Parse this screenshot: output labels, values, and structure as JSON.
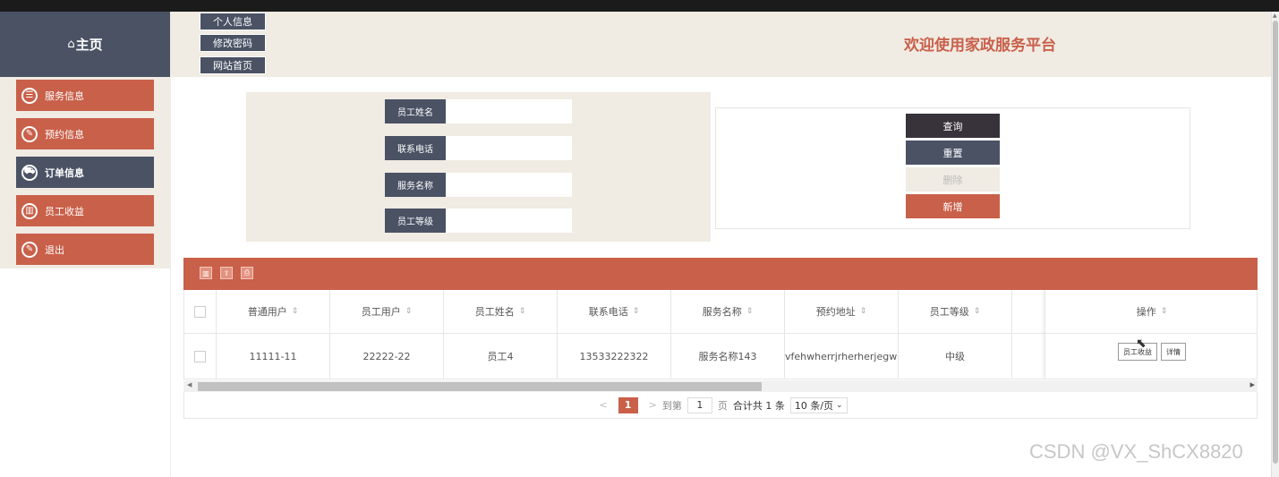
{
  "nav": {
    "home_label": "主页",
    "items": [
      {
        "label": "服务信息",
        "icon": "document-icon",
        "glyph": "☰"
      },
      {
        "label": "预约信息",
        "icon": "edit-icon",
        "glyph": "✎"
      },
      {
        "label": "订单信息",
        "icon": "bus-icon",
        "glyph": "⛟"
      },
      {
        "label": "员工收益",
        "icon": "chart-icon",
        "glyph": "▥"
      },
      {
        "label": "退出",
        "icon": "edit-icon",
        "glyph": "✎"
      }
    ],
    "active_index": 2
  },
  "header": {
    "buttons": [
      "个人信息",
      "修改密码",
      "网站首页"
    ],
    "welcome": "欢迎使用家政服务平台"
  },
  "search": {
    "fields": [
      {
        "label": "员工姓名",
        "value": ""
      },
      {
        "label": "联系电话",
        "value": ""
      },
      {
        "label": "服务名称",
        "value": ""
      },
      {
        "label": "员工等级",
        "value": ""
      }
    ]
  },
  "actions": {
    "query": "查询",
    "reset": "重置",
    "delete": "删除",
    "add": "新增"
  },
  "table": {
    "columns": [
      "普通用户",
      "员工用户",
      "员工姓名",
      "联系电话",
      "服务名称",
      "预约地址",
      "员工等级"
    ],
    "action_column": "操作",
    "rows": [
      {
        "cells": [
          "11111-11",
          "22222-22",
          "员工4",
          "13533222322",
          "服务名称143",
          "vfehwherrjrherherjegwgwt",
          "中级"
        ],
        "buttons": [
          "员工收益",
          "详情"
        ]
      }
    ]
  },
  "pagination": {
    "prev": "<",
    "current": "1",
    "next": ">",
    "goto_prefix": "到第",
    "goto_value": "1",
    "goto_suffix": "页",
    "total": "合计共 1 条",
    "page_size": "10 条/页"
  },
  "watermark": "CSDN @VX_ShCX8820",
  "colors": {
    "primary": "#c9604a",
    "dark": "#4a5264",
    "beige": "#f0ebe3"
  }
}
